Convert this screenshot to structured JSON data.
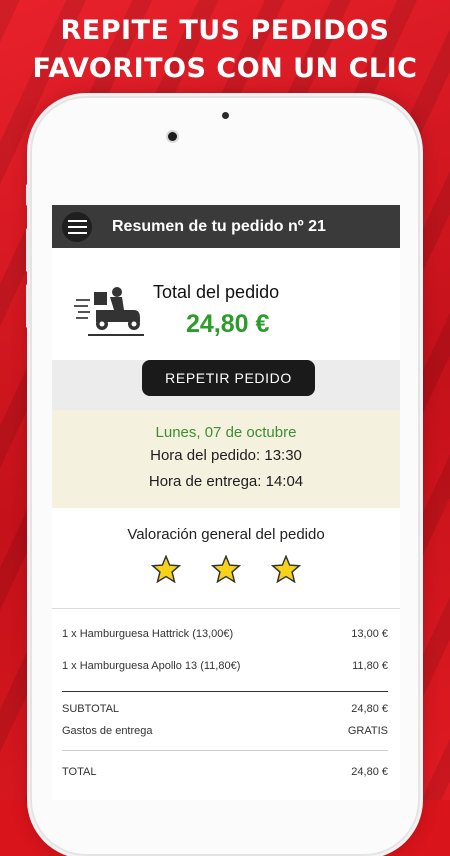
{
  "headline": {
    "line1": "REPITE TUS PEDIDOS",
    "line2": "FAVORITOS CON UN CLIC"
  },
  "app": {
    "title": "Resumen de tu pedido nº 21",
    "total_label": "Total del pedido",
    "total_value": "24,80 €",
    "repeat_button": "REPETIR PEDIDO",
    "date": "Lunes, 07 de octubre",
    "order_time": "Hora del pedido: 13:30",
    "delivery_time": "Hora de entrega: 14:04",
    "rating_label": "Valoración general del pedido",
    "rating_stars": 3,
    "items": [
      {
        "name": "1 x Hamburguesa Hattrick (13,00€)",
        "price": "13,00 €"
      },
      {
        "name": "1 x Hamburguesa Apollo 13 (11,80€)",
        "price": "11,80 €"
      }
    ],
    "subtotal_label": "SUBTOTAL",
    "subtotal_value": "24,80 €",
    "delivery_label": "Gastos de entrega",
    "delivery_value": "GRATIS",
    "grand_total_label": "TOTAL",
    "grand_total_value": "24,80 €"
  },
  "icons": {
    "menu": "hamburger-menu-icon",
    "delivery": "delivery-scooter-icon",
    "star": "star-icon"
  },
  "colors": {
    "background_red": "#d9141b",
    "appbar": "#3a3a3a",
    "total_green": "#2a9d2a",
    "date_green": "#3b8f2f",
    "dates_band": "#f5f1df",
    "star_yellow": "#f7d21a"
  }
}
